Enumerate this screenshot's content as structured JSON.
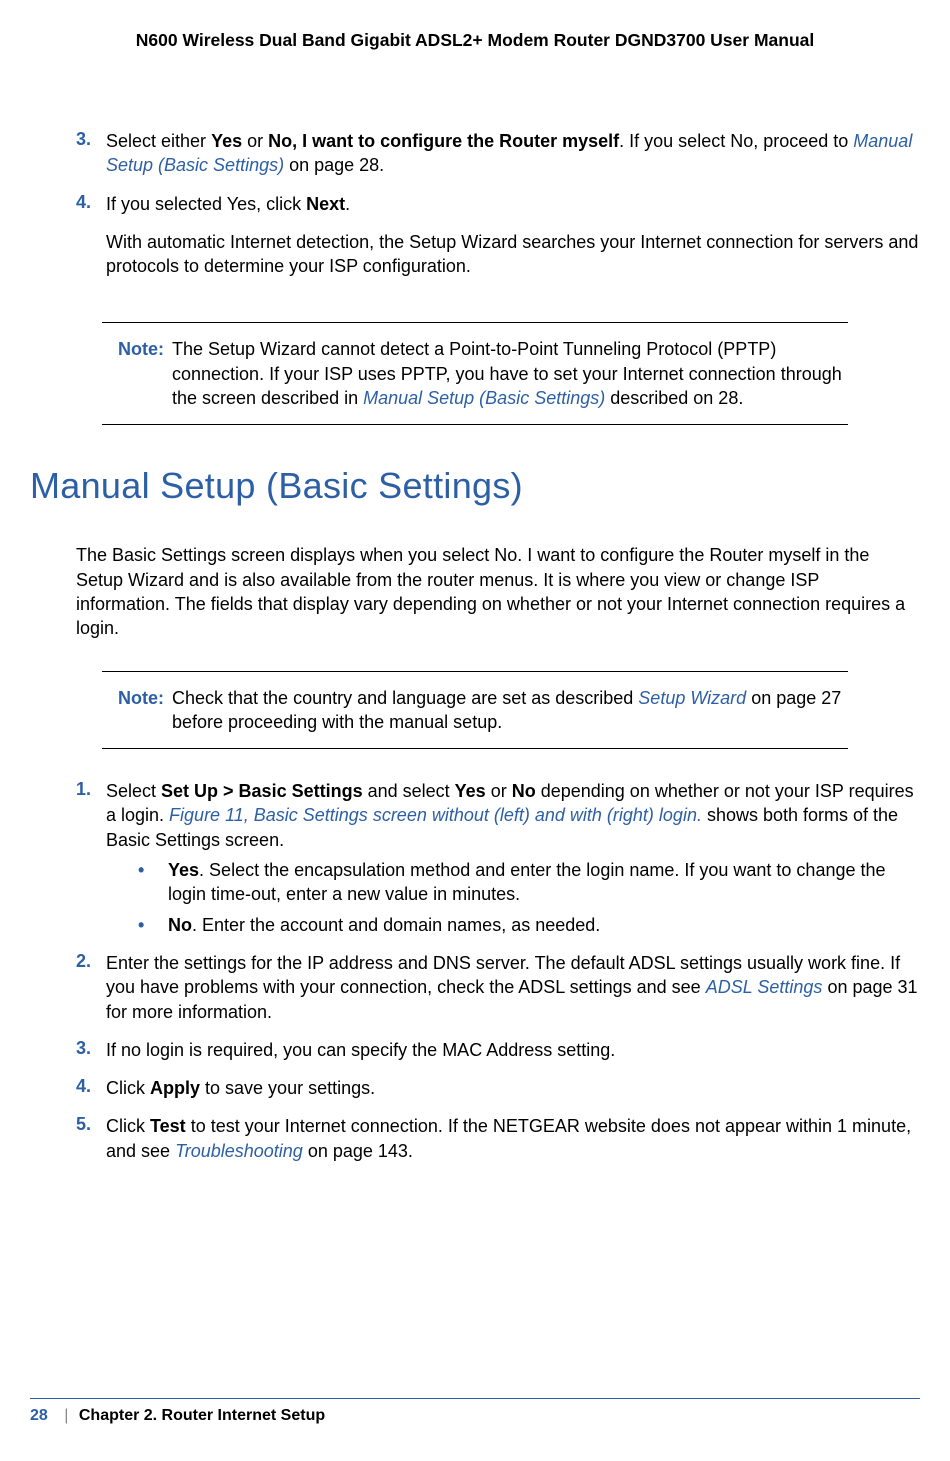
{
  "header": {
    "title": "N600 Wireless Dual Band Gigabit ADSL2+ Modem Router DGND3700 User Manual"
  },
  "top_steps": {
    "s3": {
      "num": "3.",
      "t1": "Select either ",
      "b1": "Yes",
      "t2": " or ",
      "b2": "No, I want to configure the Router myself",
      "t3": ". If you select No, proceed to ",
      "link1": "Manual Setup (Basic Settings)",
      "t4": " on page 28."
    },
    "s4": {
      "num": "4.",
      "t1": "If you selected Yes, click ",
      "b1": "Next",
      "t2": ".",
      "para2": "With automatic Internet detection, the Setup Wizard searches your Internet connection for servers and protocols to determine your ISP configuration."
    }
  },
  "note1": {
    "label": "Note:",
    "t1": "The Setup Wizard cannot detect a Point-to-Point Tunneling Protocol (PPTP) connection. If your ISP uses PPTP, you have to set your Internet connection through the screen described in ",
    "link1": "Manual Setup (Basic Settings)",
    "t2": " described on 28."
  },
  "section_heading": "Manual Setup (Basic Settings)",
  "intro_para": "The Basic Settings screen displays when you select No. I want to configure the Router myself in the Setup Wizard and is also available from the router menus. It is where you view or change ISP information. The fields that display vary depending on whether or not your Internet connection requires a login.",
  "note2": {
    "label": "Note:",
    "t1": "Check that the country and language are set as described ",
    "link1": "Setup Wizard",
    "t2": " on page 27 before proceeding with the manual setup."
  },
  "steps2": {
    "s1": {
      "num": "1.",
      "t1": "Select ",
      "b1": "Set Up > Basic Settings",
      "t2": " and select ",
      "b2": "Yes",
      "t3": " or ",
      "b3": "No",
      "t4": " depending on whether or not your ISP requires a login. ",
      "link1": "Figure 11, Basic Settings screen without (left) and with (right) login.",
      "t5": " shows both forms of the Basic Settings screen.",
      "bullet_yes": {
        "b": "Yes",
        "t": ". Select the encapsulation method and enter the login name. If you want to change the login time-out, enter a new value in minutes."
      },
      "bullet_no": {
        "b": "No",
        "t": ". Enter the account and domain names, as needed."
      }
    },
    "s2": {
      "num": "2.",
      "t1": "Enter the settings for the IP address and DNS server. The default ADSL settings usually work fine. If you have problems with your connection, check the ADSL settings and see ",
      "link1": "ADSL Settings",
      "t2": " on page 31 for more information."
    },
    "s3": {
      "num": "3.",
      "t1": "If no login is required, you can specify the MAC Address setting."
    },
    "s4": {
      "num": "4.",
      "t1": "Click ",
      "b1": "Apply",
      "t2": " to save your settings."
    },
    "s5": {
      "num": "5.",
      "t1": "Click ",
      "b1": "Test",
      "t2": " to test your Internet connection. If the NETGEAR website does not appear within 1 minute, and see ",
      "link1": "Troubleshooting",
      "t3": " on page 143."
    }
  },
  "footer": {
    "page_num": "28",
    "separator": "|",
    "chapter": "Chapter 2.  Router Internet Setup"
  }
}
